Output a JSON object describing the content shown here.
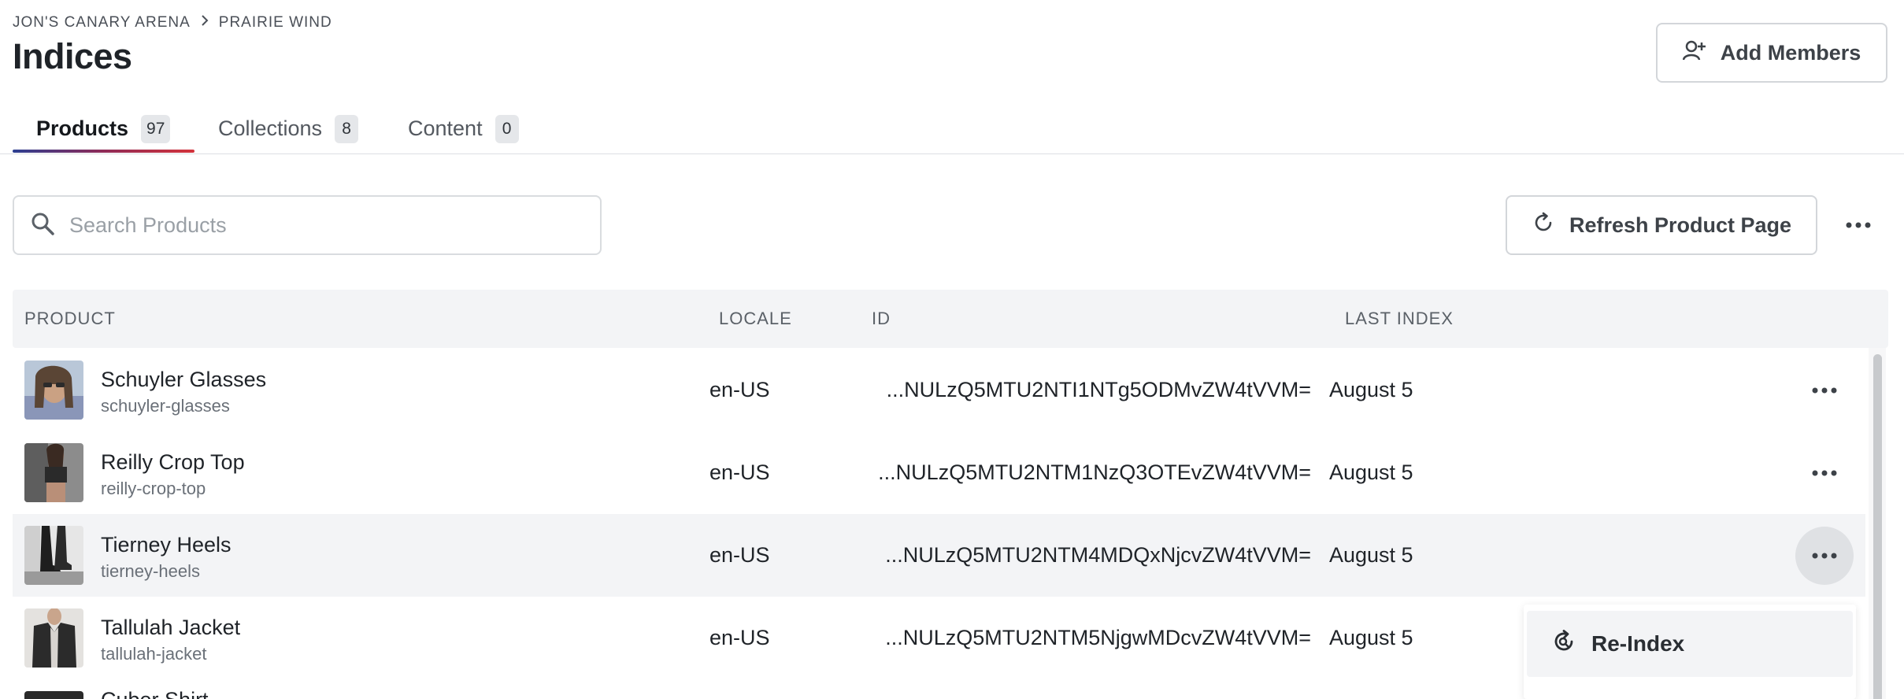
{
  "breadcrumb": {
    "parent": "JON'S CANARY ARENA",
    "current": "PRAIRIE WIND"
  },
  "page": {
    "title": "Indices"
  },
  "header": {
    "add_members_label": "Add Members"
  },
  "tabs": [
    {
      "label": "Products",
      "count": "97",
      "active": true
    },
    {
      "label": "Collections",
      "count": "8",
      "active": false
    },
    {
      "label": "Content",
      "count": "0",
      "active": false
    }
  ],
  "search": {
    "placeholder": "Search Products",
    "value": ""
  },
  "toolbar": {
    "refresh_label": "Refresh Product Page"
  },
  "table": {
    "columns": {
      "product": "PRODUCT",
      "locale": "LOCALE",
      "id": "ID",
      "last_index": "LAST INDEX"
    },
    "rows": [
      {
        "name": "Schuyler Glasses",
        "slug": "schuyler-glasses",
        "locale": "en-US",
        "id": "...NULzQ5MTU2NTI1NTg5ODMvZW4tVVM=",
        "last_index": "August 5"
      },
      {
        "name": "Reilly Crop Top",
        "slug": "reilly-crop-top",
        "locale": "en-US",
        "id": "...NULzQ5MTU2NTM1NzQ3OTEvZW4tVVM=",
        "last_index": "August 5"
      },
      {
        "name": "Tierney Heels",
        "slug": "tierney-heels",
        "locale": "en-US",
        "id": "...NULzQ5MTU2NTM4MDQxNjcvZW4tVVM=",
        "last_index": "August 5"
      },
      {
        "name": "Tallulah Jacket",
        "slug": "tallulah-jacket",
        "locale": "en-US",
        "id": "...NULzQ5MTU2NTM5NjgwMDcvZW4tVVM=",
        "last_index": "August 5"
      }
    ],
    "partial_row_name": "Cuber Shirt"
  },
  "row_menu": {
    "reindex_label": "Re-Index"
  },
  "colors": {
    "accent_start": "#2c3e91",
    "accent_end": "#d3333b",
    "hover_row": "#f3f4f6"
  }
}
